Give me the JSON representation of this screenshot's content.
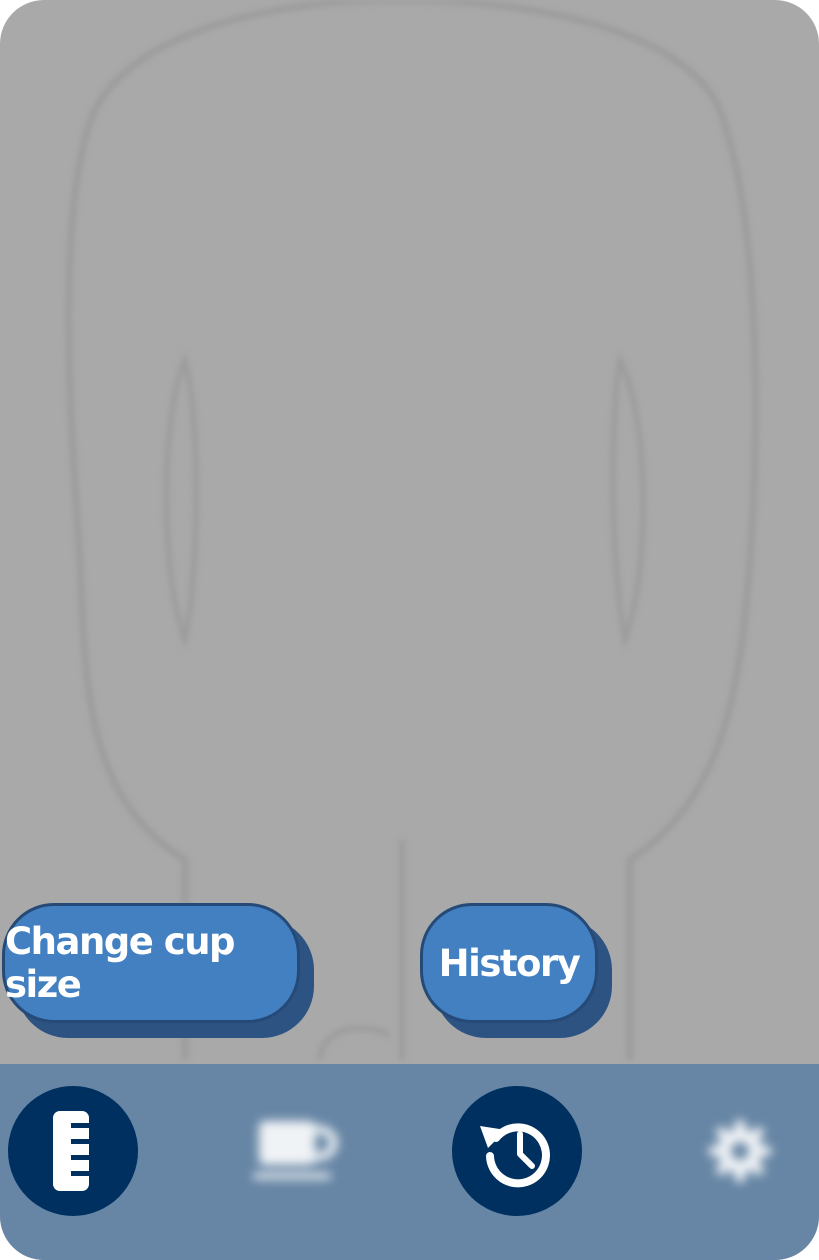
{
  "buttons": {
    "change_cup_size": "Change cup size",
    "history": "History"
  },
  "nav": {
    "items": [
      {
        "icon": "ruler-icon",
        "active": true
      },
      {
        "icon": "coffee-cup-icon",
        "active": false
      },
      {
        "icon": "history-clock-icon",
        "active": true
      },
      {
        "icon": "settings-gear-icon",
        "active": false
      }
    ]
  },
  "colors": {
    "background": "#a9a9a9",
    "button_fill": "#4380c2",
    "button_shadow": "#2d5383",
    "nav_bar": "#6786a5",
    "nav_active": "#00305f"
  }
}
